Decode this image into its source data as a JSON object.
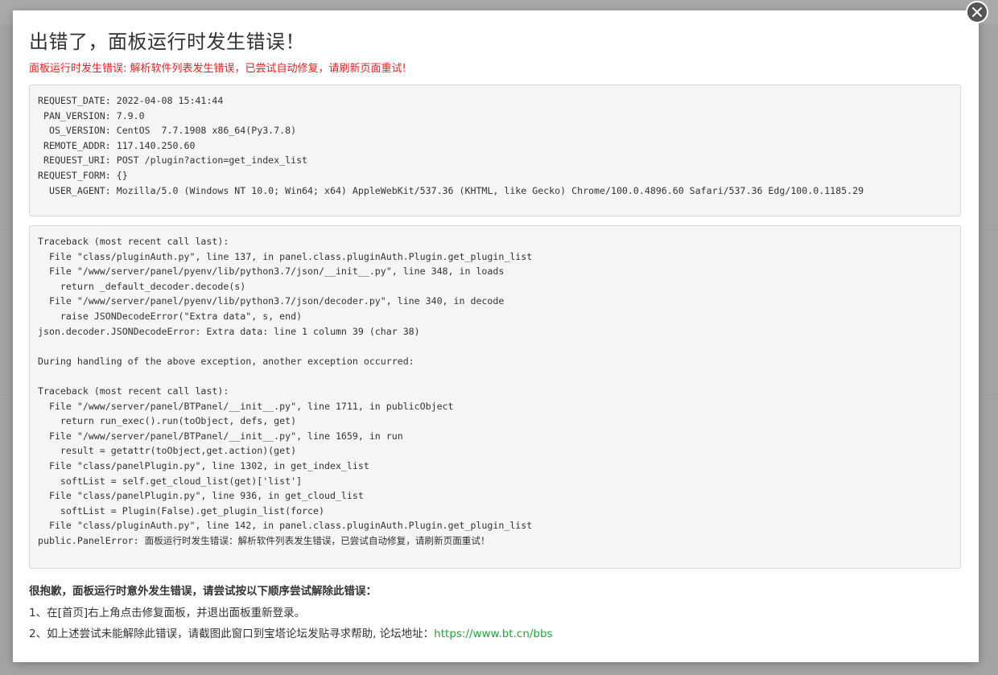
{
  "dialog": {
    "title": "出错了，面板运行时发生错误！",
    "subtitle": "面板运行时发生错误: 解析软件列表发生错误，已尝试自动修复，请刷新页面重试!",
    "close_icon": "close-icon"
  },
  "request_info": [
    "REQUEST_DATE: 2022-04-08 15:41:44",
    " PAN_VERSION: 7.9.0",
    "  OS_VERSION: CentOS  7.7.1908 x86_64(Py3.7.8)",
    " REMOTE_ADDR: 117.140.250.60",
    " REQUEST_URI: POST /plugin?action=get_index_list",
    "REQUEST_FORM: {}",
    "  USER_AGENT: Mozilla/5.0 (Windows NT 10.0; Win64; x64) AppleWebKit/537.36 (KHTML, like Gecko) Chrome/100.0.4896.60 Safari/537.36 Edg/100.0.1185.29"
  ],
  "traceback": [
    "Traceback (most recent call last):",
    "  File \"class/pluginAuth.py\", line 137, in panel.class.pluginAuth.Plugin.get_plugin_list",
    "  File \"/www/server/panel/pyenv/lib/python3.7/json/__init__.py\", line 348, in loads",
    "    return _default_decoder.decode(s)",
    "  File \"/www/server/panel/pyenv/lib/python3.7/json/decoder.py\", line 340, in decode",
    "    raise JSONDecodeError(\"Extra data\", s, end)",
    "json.decoder.JSONDecodeError: Extra data: line 1 column 39 (char 38)",
    "",
    "During handling of the above exception, another exception occurred:",
    "",
    "Traceback (most recent call last):",
    "  File \"/www/server/panel/BTPanel/__init__.py\", line 1711, in publicObject",
    "    return run_exec().run(toObject, defs, get)",
    "  File \"/www/server/panel/BTPanel/__init__.py\", line 1659, in run",
    "    result = getattr(toObject,get.action)(get)",
    "  File \"class/panelPlugin.py\", line 1302, in get_index_list",
    "    softList = self.get_cloud_list(get)['list']",
    "  File \"class/panelPlugin.py\", line 936, in get_cloud_list",
    "    softList = Plugin(False).get_plugin_list(force)",
    "  File \"class/pluginAuth.py\", line 142, in panel.class.pluginAuth.Plugin.get_plugin_list",
    "public.PanelError: 面板运行时发生错误：解析软件列表发生错误，已尝试自动修复，请刷新页面重试！"
  ],
  "help": {
    "title": "很抱歉，面板运行时意外发生错误，请尝试按以下顺序尝试解除此错误：",
    "step1": "1、在[首页]右上角点击修复面板，并退出面板重新登录。",
    "step2_text": "2、如上述尝试未能解除此错误，请截图此窗口到宝塔论坛发贴寻求帮助, 论坛地址：",
    "step2_link": "https://www.bt.cn/bbs"
  }
}
